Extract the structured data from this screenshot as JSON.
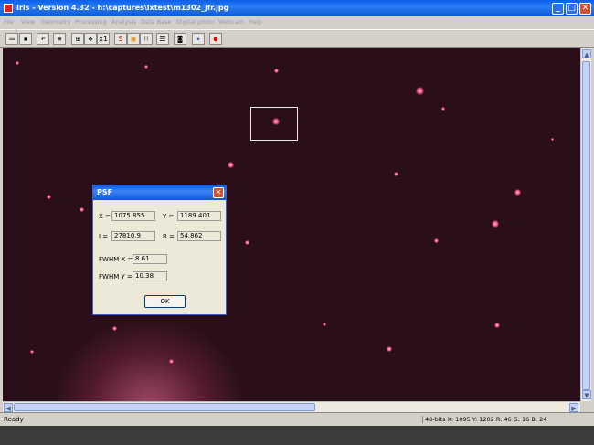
{
  "window": {
    "title": "Iris - Version 4.32 - h:\\captures\\lxtest\\m1302_jfr.jpg",
    "minimize": "_",
    "maximize": "□",
    "close": "✕"
  },
  "menu": [
    "File",
    "View",
    "Geometry",
    "Processing",
    "Analysis",
    "Data Base",
    "Digital photo",
    "Webcam",
    "Help"
  ],
  "toolbar": {
    "icons": [
      "open-icon",
      "save-icon",
      "undo-icon",
      "settings-icon",
      "zoom-fit-icon",
      "move-icon",
      "zoom-1x-icon",
      "scale-icon",
      "palette-icon",
      "histogram-icon",
      "list-icon",
      "camera-icon",
      "target-icon",
      "record-icon"
    ],
    "glyphs": [
      "▭",
      "▪",
      "↶",
      "≡",
      "⊞",
      "✥",
      "x1",
      "S",
      "▣",
      "H",
      "☰",
      "◙",
      "✦",
      "●"
    ]
  },
  "psf_dialog": {
    "title": "PSF",
    "x_label": "X =",
    "x_value": "1075.855",
    "y_label": "Y =",
    "y_value": "1189.401",
    "i_label": "I =",
    "i_value": "27810.9",
    "b_label": "B =",
    "b_value": "54.862",
    "fwhm_x_label": "FWHM X =",
    "fwhm_x_value": "8.61",
    "fwhm_y_label": "FWHM Y =",
    "fwhm_y_value": "10.38",
    "ok_label": "OK",
    "close_glyph": "✕"
  },
  "statusbar": {
    "ready": "Ready",
    "info": "48-bits X: 1095  Y: 1202  R: 46  G: 16  B: 24"
  },
  "scroll": {
    "up": "▲",
    "down": "▼",
    "left": "◀",
    "right": "▶"
  },
  "colors": {
    "sky": "#2a0f1a",
    "star": "#ff4f88",
    "titlebar": "#0a5ee8"
  }
}
